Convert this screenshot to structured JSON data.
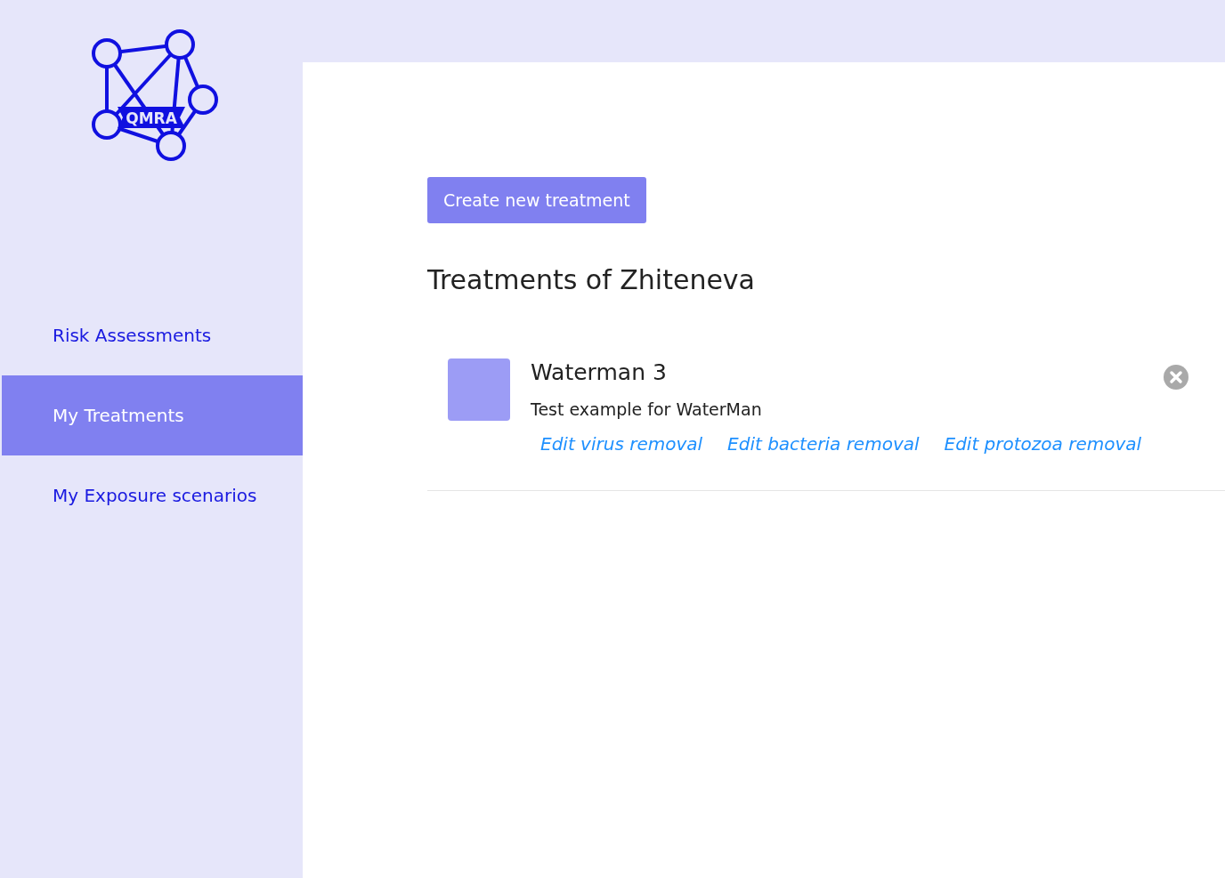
{
  "logo": {
    "text": "QMRA"
  },
  "sidebar": {
    "items": [
      {
        "label": "Risk Assessments",
        "selected": false
      },
      {
        "label": "My Treatments",
        "selected": true
      },
      {
        "label": "My Exposure scenarios",
        "selected": false
      }
    ]
  },
  "create_button": "Create new treatment",
  "heading": "Treatments of Zhiteneva",
  "treatments": [
    {
      "name": "Waterman 3",
      "description": "Test example for WaterMan",
      "links": [
        "Edit virus removal",
        "Edit bacteria removal",
        "Edit protozoa removal"
      ]
    }
  ]
}
